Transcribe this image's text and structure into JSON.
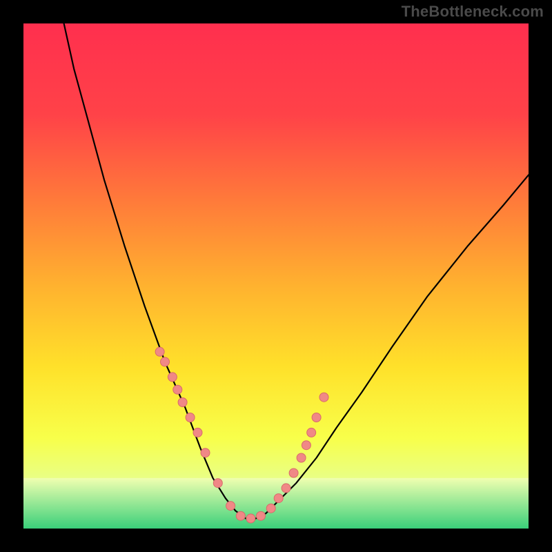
{
  "watermark": "TheBottleneck.com",
  "colors": {
    "page_bg": "#000000",
    "curve": "#000000",
    "dot_fill": "#f08886",
    "dot_stroke": "#d86b69",
    "bottom_band_top": "#f2ffb8",
    "bottom_band_bottom": "#3ad07a"
  },
  "gradient_stops": [
    {
      "offset": 0.0,
      "color": "#ff2f4e"
    },
    {
      "offset": 0.18,
      "color": "#ff4248"
    },
    {
      "offset": 0.35,
      "color": "#ff7a3a"
    },
    {
      "offset": 0.52,
      "color": "#ffb22f"
    },
    {
      "offset": 0.68,
      "color": "#ffe12a"
    },
    {
      "offset": 0.82,
      "color": "#f8ff4a"
    },
    {
      "offset": 0.9,
      "color": "#e9ff84"
    },
    {
      "offset": 1.0,
      "color": "#3ad07a"
    }
  ],
  "chart_data": {
    "type": "line",
    "title": "",
    "xlabel": "",
    "ylabel": "",
    "xlim": [
      0,
      100
    ],
    "ylim": [
      0,
      100
    ],
    "series": [
      {
        "name": "bottleneck-curve",
        "x": [
          8,
          10,
          13,
          16,
          20,
          24,
          28,
          32,
          35,
          37.5,
          40,
          42,
          44,
          46,
          48,
          50,
          54,
          58,
          62,
          67,
          73,
          80,
          88,
          95,
          100
        ],
        "y": [
          100,
          91,
          80,
          69,
          56,
          44,
          33,
          24,
          16,
          10,
          6,
          3.5,
          2,
          2,
          3,
          5,
          9,
          14,
          20,
          27,
          36,
          46,
          56,
          64,
          70
        ]
      }
    ],
    "dots": {
      "name": "highlight-points",
      "x": [
        27,
        28,
        29.5,
        30.5,
        31.5,
        33,
        34.5,
        36,
        38.5,
        41,
        43,
        45,
        47,
        49,
        50.5,
        52,
        53.5,
        55,
        56,
        57,
        58,
        59.5
      ],
      "y": [
        35,
        33,
        30,
        27.5,
        25,
        22,
        19,
        15,
        9,
        4.5,
        2.5,
        2,
        2.5,
        4,
        6,
        8,
        11,
        14,
        16.5,
        19,
        22,
        26
      ]
    },
    "bottom_band_y_fraction": 0.1
  }
}
